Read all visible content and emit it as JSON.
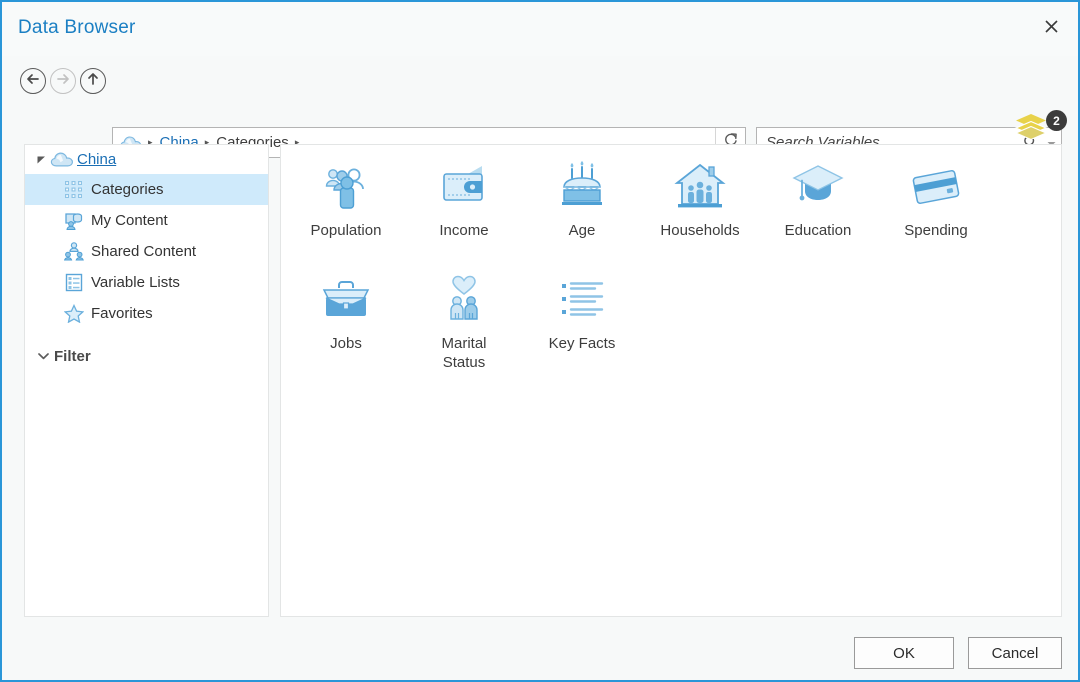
{
  "window": {
    "title": "Data Browser",
    "close_icon": "close-icon",
    "border_color": "#2a96d8",
    "title_color": "#1b7fc3"
  },
  "nav": {
    "back_label": "Back",
    "back_icon": "arrow-left-circle-icon",
    "forward_label": "Forward",
    "forward_icon": "arrow-right-circle-icon",
    "forward_disabled": true,
    "up_label": "Up",
    "up_icon": "arrow-up-circle-icon"
  },
  "address": {
    "root_icon": "cloud-icon",
    "crumbs": [
      {
        "label": "China",
        "link": true
      },
      {
        "label": "Categories",
        "link": false
      }
    ],
    "separator": "▸",
    "refresh_icon": "refresh-icon",
    "refresh_label": "Refresh"
  },
  "search": {
    "placeholder": "Search Variables",
    "value": "",
    "search_icon": "search-icon",
    "dropdown_icon": "chevron-down-icon"
  },
  "layers_badge": {
    "icon": "stacked-layers-icon",
    "count": "2",
    "icon_color": "#e8d24a",
    "badge_color": "#3c3c3c"
  },
  "sidebar": {
    "root": {
      "label": "China",
      "icon": "cloud-icon",
      "expander_icon": "triangle-expanded-icon",
      "expanded": true
    },
    "items": [
      {
        "label": "Categories",
        "icon": "grid-dots-icon",
        "selected": true
      },
      {
        "label": "My Content",
        "icon": "my-content-icon",
        "selected": false
      },
      {
        "label": "Shared Content",
        "icon": "shared-content-icon",
        "selected": false
      },
      {
        "label": "Variable Lists",
        "icon": "list-panel-icon",
        "selected": false
      },
      {
        "label": "Favorites",
        "icon": "star-icon",
        "selected": false
      }
    ],
    "filter": {
      "label": "Filter",
      "chevron_icon": "chevron-down-icon",
      "expanded": false
    },
    "selection_color": "#cfeafb"
  },
  "content": {
    "tiles": [
      {
        "label": "Population",
        "icon": "people-group-icon"
      },
      {
        "label": "Income",
        "icon": "wallet-icon"
      },
      {
        "label": "Age",
        "icon": "birthday-cake-icon"
      },
      {
        "label": "Households",
        "icon": "house-people-icon"
      },
      {
        "label": "Education",
        "icon": "graduation-cap-icon"
      },
      {
        "label": "Spending",
        "icon": "credit-card-icon"
      },
      {
        "label": "Jobs",
        "icon": "briefcase-icon"
      },
      {
        "label": "Marital\nStatus",
        "icon": "heart-couple-icon"
      },
      {
        "label": "Key Facts",
        "icon": "bullet-list-icon"
      }
    ],
    "icon_color": "#4d9fd4",
    "icon_color_light": "#cfe6f5"
  },
  "footer": {
    "ok_label": "OK",
    "cancel_label": "Cancel"
  }
}
